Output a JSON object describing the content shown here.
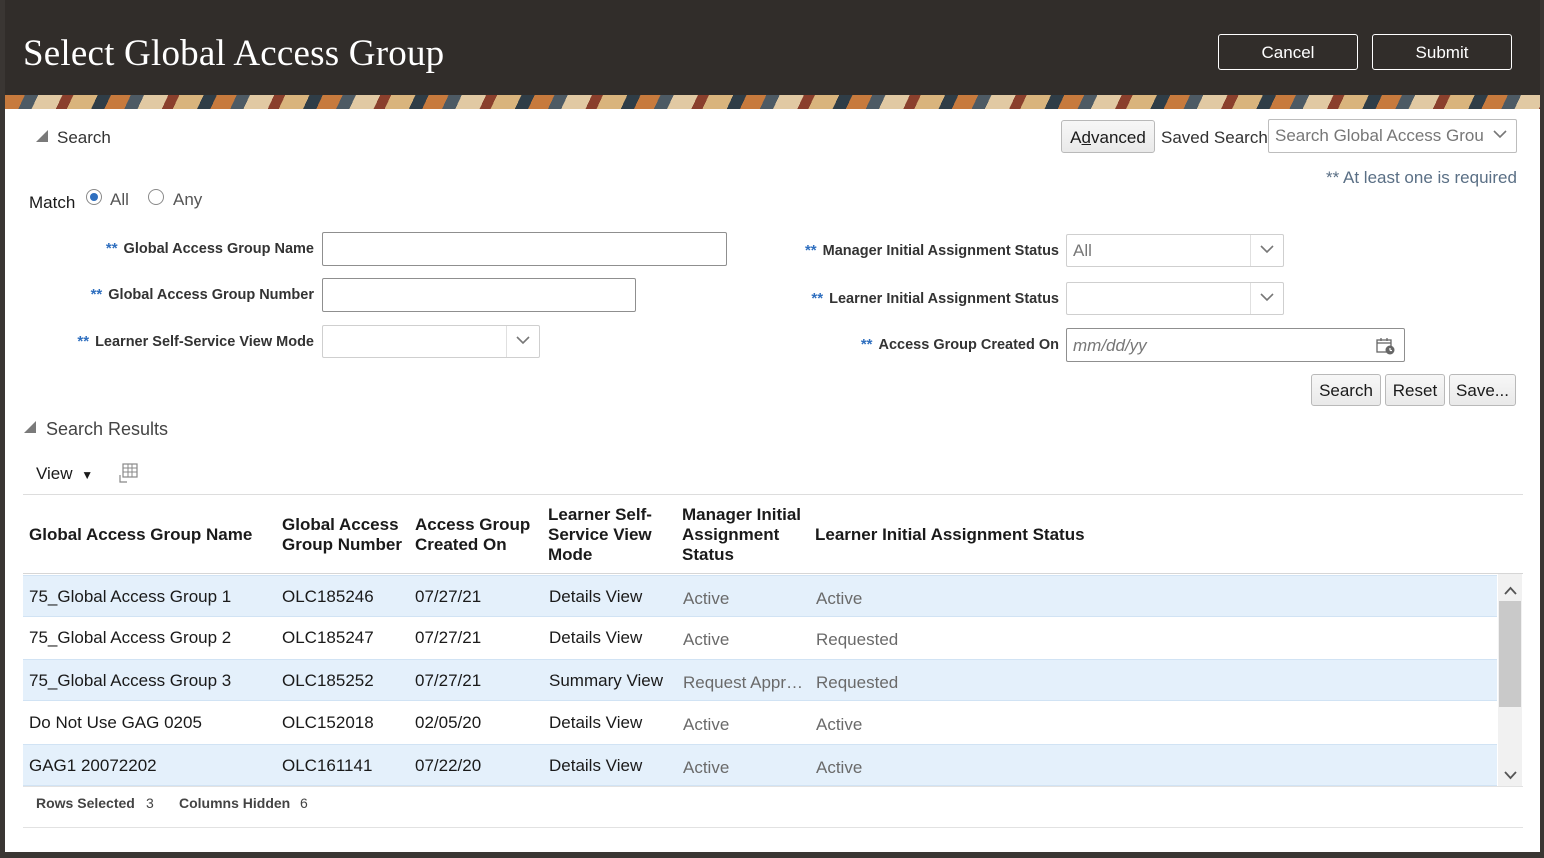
{
  "dialog": {
    "title": "Select Global Access Group",
    "cancel_label": "Cancel",
    "submit_label": "Submit"
  },
  "search": {
    "section_label": "Search",
    "advanced_label": "Advanced",
    "saved_search_label": "Saved Search",
    "saved_search_value": "Search Global Access Groups",
    "required_note": "** At least one is required",
    "match_label": "Match",
    "match_all": "All",
    "match_any": "Any",
    "match_selected": "All",
    "required_marker": "**",
    "fields": {
      "gag_name_label": "Global Access Group Name",
      "gag_number_label": "Global Access Group Number",
      "view_mode_label": "Learner Self-Service View Mode",
      "manager_status_label": "Manager Initial Assignment Status",
      "manager_status_value": "All",
      "learner_status_label": "Learner Initial Assignment Status",
      "created_on_label": "Access Group Created On",
      "created_on_placeholder": "mm/dd/yy"
    },
    "buttons": {
      "search": "Search",
      "reset": "Reset",
      "save": "Save..."
    }
  },
  "results": {
    "section_label": "Search Results",
    "view_menu": "View",
    "columns": [
      "Global Access Group Name",
      "Global Access Group Number",
      "Access Group Created On",
      "Learner Self-Service View Mode",
      "Manager Initial Assignment Status",
      "Learner Initial Assignment Status"
    ],
    "rows": [
      {
        "name": "75_Global Access Group 1",
        "number": "OLC185246",
        "created": "07/27/21",
        "view_mode": "Details View",
        "manager_status": "Active",
        "learner_status": "Active",
        "selected": true
      },
      {
        "name": "75_Global Access Group 2",
        "number": "OLC185247",
        "created": "07/27/21",
        "view_mode": "Details View",
        "manager_status": "Active",
        "learner_status": "Requested",
        "selected": false
      },
      {
        "name": "75_Global Access Group 3",
        "number": "OLC185252",
        "created": "07/27/21",
        "view_mode": "Summary View",
        "manager_status": "Request Appr…",
        "learner_status": "Requested",
        "selected": true
      },
      {
        "name": "Do Not Use GAG 0205",
        "number": "OLC152018",
        "created": "02/05/20",
        "view_mode": "Details View",
        "manager_status": "Active",
        "learner_status": "Active",
        "selected": false
      },
      {
        "name": "GAG1 20072202",
        "number": "OLC161141",
        "created": "07/22/20",
        "view_mode": "Details View",
        "manager_status": "Active",
        "learner_status": "Active",
        "selected": true
      }
    ],
    "footer": {
      "rows_selected_label": "Rows Selected",
      "rows_selected_value": "3",
      "columns_hidden_label": "Columns Hidden",
      "columns_hidden_value": "6"
    }
  },
  "colors": {
    "header_bg": "#312d2a",
    "accent": "#2f6fbf",
    "selected_row": "#e4f0fb"
  }
}
